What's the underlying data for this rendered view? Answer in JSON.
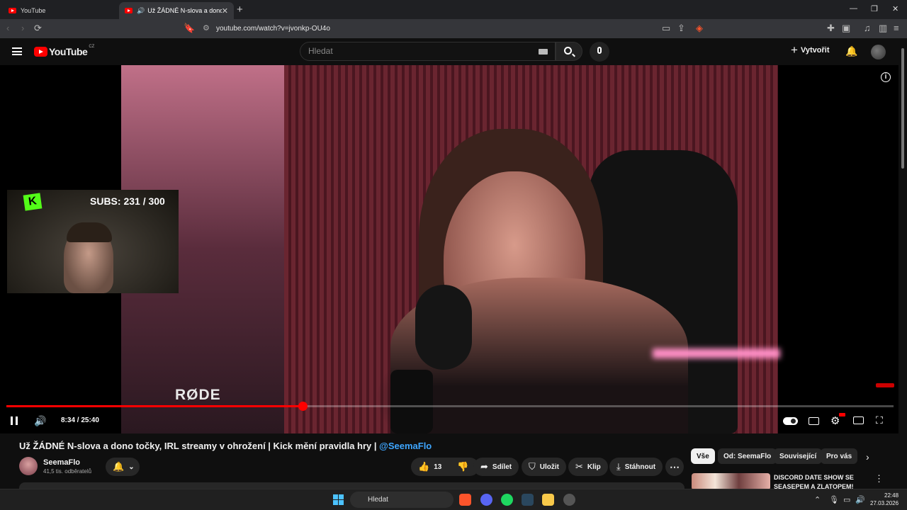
{
  "browser": {
    "tabs": [
      {
        "title": "YouTube",
        "active": false
      },
      {
        "title": "Už ŽÁDNÉ N-slova a dono točky, IRL streamy v ohrožení | Kick mění pravidla hry",
        "active": true
      }
    ],
    "url": "youtube.com/watch?v=jvonkp-OU4o"
  },
  "header": {
    "logo": "YouTube",
    "region": "CZ",
    "search_placeholder": "Hledat",
    "create_label": "Vytvořit"
  },
  "player": {
    "overlay_subs": "SUBS: 231 / 300",
    "overlay_logo_letter": "K",
    "brand_text": "RØDE",
    "time": "8:34 / 25:40",
    "progress_fraction": 0.334
  },
  "video": {
    "title": "Už ŽÁDNÉ N-slova a dono točky, IRL streamy v ohrožení | Kick mění pravidla hry | ",
    "mention": "@SeemaFlo",
    "channel": "SeemaFlo",
    "subscribers": "41,5 tis. odběratelů",
    "likes": "13",
    "share": "Sdílet",
    "save": "Uložit",
    "clip": "Klip",
    "download": "Stáhnout"
  },
  "sidebar": {
    "chips": [
      "Vše",
      "Od: SeemaFlo",
      "Související",
      "Pro vás"
    ],
    "recommendation_title": "DISCORD DATE SHOW SE SEASEPEM A ZLATOPEM!"
  },
  "taskbar": {
    "search": "Hledat",
    "time": "22:48",
    "date": "27.03.2026"
  },
  "colors": {
    "accent_red": "#ff0000",
    "link_blue": "#3ea6ff",
    "kick_green": "#53fc18"
  }
}
